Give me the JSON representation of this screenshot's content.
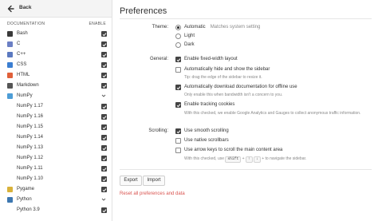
{
  "sidebar": {
    "back_label": "Back",
    "col_documentation": "DOCUMENTATION",
    "col_enable": "ENABLE",
    "items": [
      {
        "label": "Bash",
        "icon": "bash-icon",
        "color": "#3a3a3a",
        "control": "checkbox",
        "checked": true,
        "child": false
      },
      {
        "label": "C",
        "icon": "c-icon",
        "color": "#6b7fc4",
        "control": "checkbox",
        "checked": true,
        "child": false
      },
      {
        "label": "C++",
        "icon": "cpp-icon",
        "color": "#5b79c0",
        "control": "checkbox",
        "checked": true,
        "child": false
      },
      {
        "label": "CSS",
        "icon": "css-icon",
        "color": "#3b7ed1",
        "control": "checkbox",
        "checked": true,
        "child": false
      },
      {
        "label": "HTML",
        "icon": "html-icon",
        "color": "#e0603a",
        "control": "checkbox",
        "checked": true,
        "child": false
      },
      {
        "label": "Markdown",
        "icon": "markdown-icon",
        "color": "#555555",
        "control": "checkbox",
        "checked": true,
        "child": false
      },
      {
        "label": "NumPy",
        "icon": "numpy-icon",
        "color": "#4d9dd6",
        "control": "chevron",
        "checked": false,
        "child": false
      },
      {
        "label": "NumPy 1.17",
        "icon": "",
        "color": "",
        "control": "checkbox",
        "checked": true,
        "child": true
      },
      {
        "label": "NumPy 1.16",
        "icon": "",
        "color": "",
        "control": "checkbox",
        "checked": true,
        "child": true
      },
      {
        "label": "NumPy 1.15",
        "icon": "",
        "color": "",
        "control": "checkbox",
        "checked": true,
        "child": true
      },
      {
        "label": "NumPy 1.14",
        "icon": "",
        "color": "",
        "control": "checkbox",
        "checked": true,
        "child": true
      },
      {
        "label": "NumPy 1.13",
        "icon": "",
        "color": "",
        "control": "checkbox",
        "checked": true,
        "child": true
      },
      {
        "label": "NumPy 1.12",
        "icon": "",
        "color": "",
        "control": "checkbox",
        "checked": true,
        "child": true
      },
      {
        "label": "NumPy 1.11",
        "icon": "",
        "color": "",
        "control": "checkbox",
        "checked": true,
        "child": true
      },
      {
        "label": "NumPy 1.10",
        "icon": "",
        "color": "",
        "control": "checkbox",
        "checked": true,
        "child": true
      },
      {
        "label": "Pygame",
        "icon": "pygame-icon",
        "color": "#d9b23a",
        "control": "checkbox",
        "checked": true,
        "child": false
      },
      {
        "label": "Python",
        "icon": "python-icon",
        "color": "#3d77b0",
        "control": "chevron",
        "checked": false,
        "child": false
      },
      {
        "label": "Python 3.9",
        "icon": "",
        "color": "",
        "control": "checkbox",
        "checked": true,
        "child": true
      }
    ]
  },
  "main": {
    "title": "Preferences",
    "theme": {
      "label": "Theme:",
      "options": [
        {
          "label": "Automatic",
          "hint": "Matches system setting",
          "selected": true
        },
        {
          "label": "Light",
          "hint": "",
          "selected": false
        },
        {
          "label": "Dark",
          "hint": "",
          "selected": false
        }
      ]
    },
    "general": {
      "label": "General:",
      "options": [
        {
          "label": "Enable fixed-width layout",
          "checked": true,
          "note": ""
        },
        {
          "label": "Automatically hide and show the sidebar",
          "checked": false,
          "note": "Tip: drag the edge of the sidebar to resize it."
        },
        {
          "label": "Automatically download documentation for offline use",
          "checked": true,
          "note": "Only enable this when bandwidth isn't a concern to you."
        },
        {
          "label": "Enable tracking cookies",
          "checked": true,
          "note": "With this checked, we enable Google Analytics and Gauges to collect anonymous traffic information."
        }
      ]
    },
    "scrolling": {
      "label": "Scrolling:",
      "options": [
        {
          "label": "Use smooth scrolling",
          "checked": true
        },
        {
          "label": "Use native scrollbars",
          "checked": false
        },
        {
          "label": "Use arrow keys to scroll the main content area",
          "checked": false
        }
      ],
      "note_prefix": "With this checked, use",
      "keys": [
        "shift",
        "+",
        "↑",
        "↓",
        "+"
      ],
      "note_suffix": "to navigate the sidebar."
    },
    "export_label": "Export",
    "import_label": "Import",
    "reset_label": "Reset all preferences and data"
  }
}
